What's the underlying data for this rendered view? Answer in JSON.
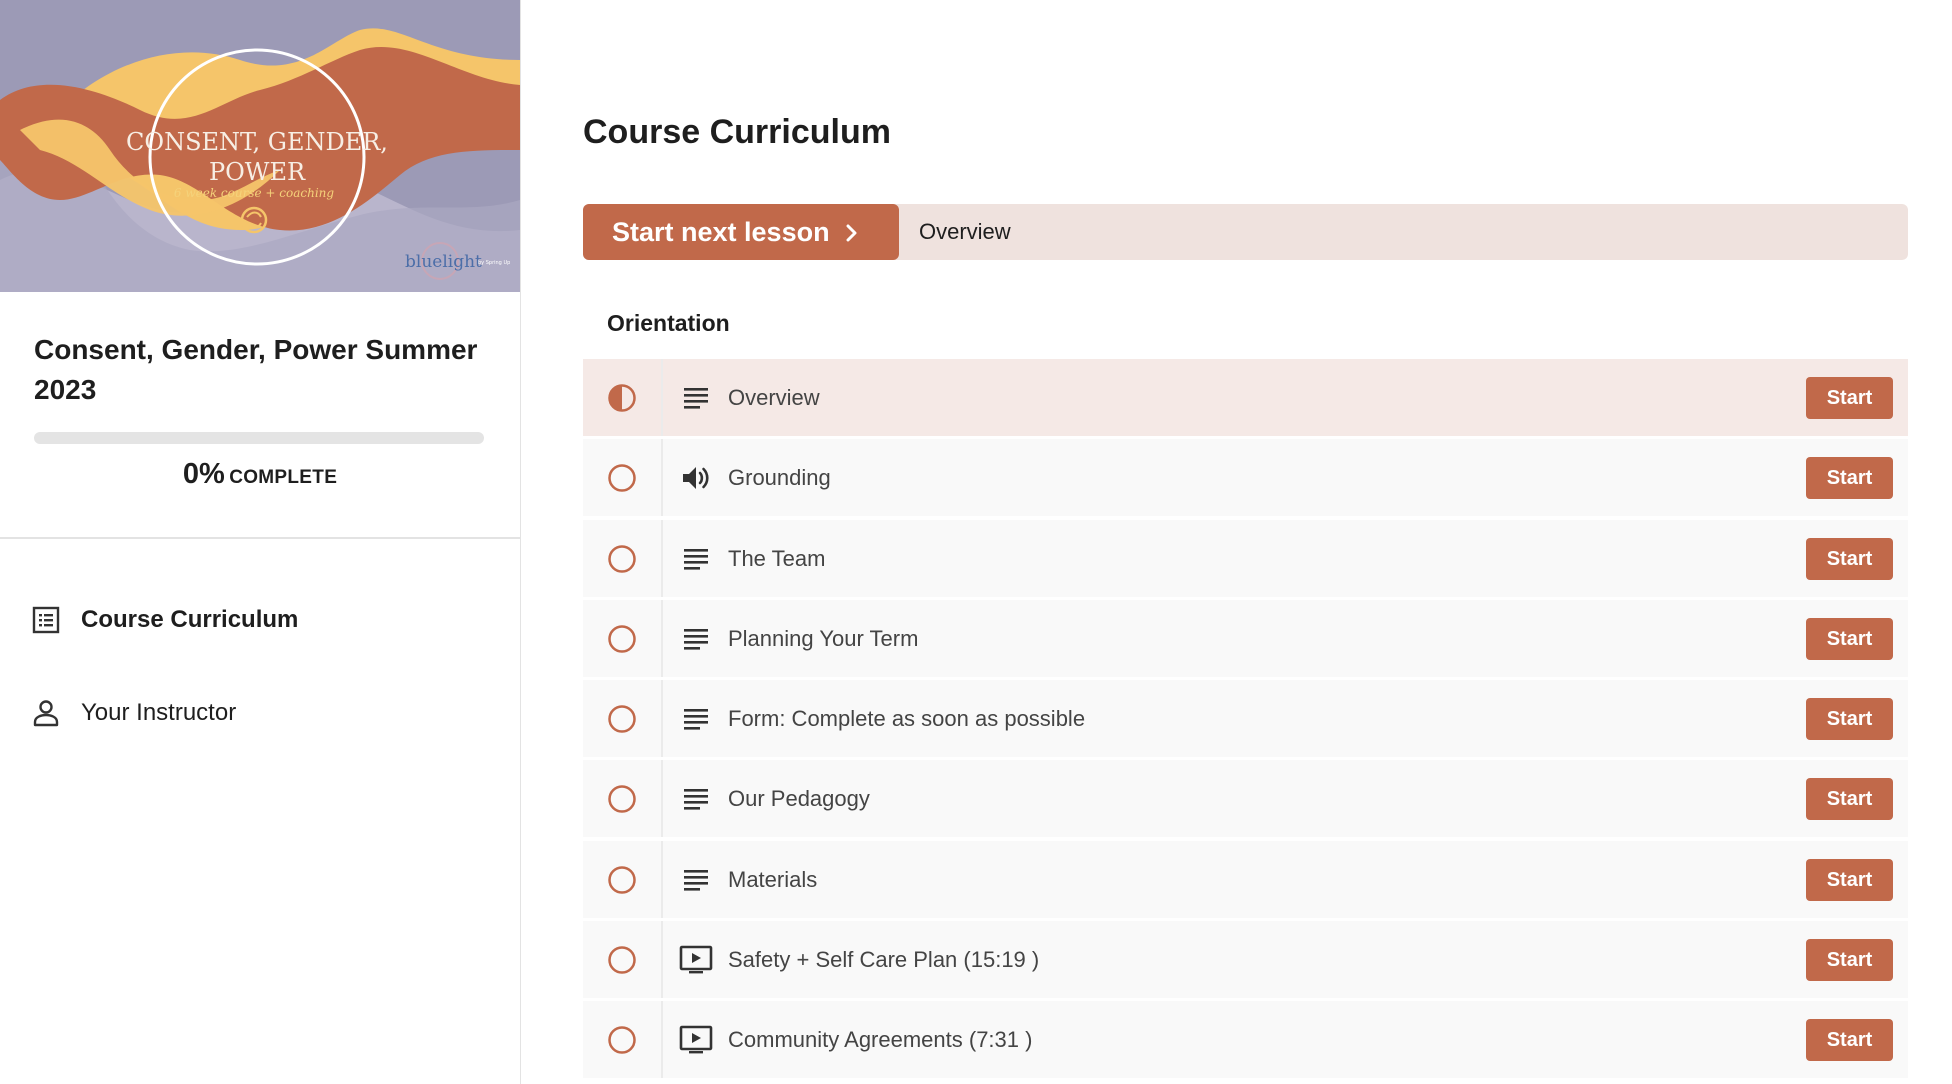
{
  "hero": {
    "title_line1": "CONSENT, GENDER,",
    "title_line2": "POWER",
    "subtitle": "6 week course + coaching",
    "brand": "bluelight",
    "brand_small": "by Spring Up"
  },
  "course": {
    "title": "Consent, Gender, Power Summer 2023",
    "progress_fraction": 0,
    "progress_percent": "0%",
    "progress_label": "COMPLETE"
  },
  "sidebar": {
    "items": [
      {
        "label": "Course Curriculum",
        "icon": "curriculum-list-icon",
        "active": true
      },
      {
        "label": "Your Instructor",
        "icon": "person-icon",
        "active": false
      }
    ]
  },
  "main": {
    "title": "Course Curriculum",
    "next_lesson": {
      "button_label": "Start next lesson",
      "lesson_name": "Overview"
    },
    "section": {
      "title": "Orientation",
      "lessons": [
        {
          "name": "Overview",
          "type": "text",
          "status": "in-progress",
          "action": "Start"
        },
        {
          "name": "Grounding",
          "type": "audio",
          "status": "not-started",
          "action": "Start"
        },
        {
          "name": "The Team",
          "type": "text",
          "status": "not-started",
          "action": "Start"
        },
        {
          "name": "Planning Your Term",
          "type": "text",
          "status": "not-started",
          "action": "Start"
        },
        {
          "name": "Form: Complete as soon as possible",
          "type": "text",
          "status": "not-started",
          "action": "Start"
        },
        {
          "name": "Our Pedagogy",
          "type": "text",
          "status": "not-started",
          "action": "Start"
        },
        {
          "name": "Materials",
          "type": "text",
          "status": "not-started",
          "action": "Start"
        },
        {
          "name": "Safety + Self Care Plan (15:19 )",
          "type": "video",
          "status": "not-started",
          "action": "Start"
        },
        {
          "name": "Community Agreements (7:31 )",
          "type": "video",
          "status": "not-started",
          "action": "Start"
        }
      ]
    }
  },
  "colors": {
    "accent": "#c1694a",
    "accent_light": "#efe2de",
    "current_row": "#f5e9e6",
    "row": "#f9f9f9"
  }
}
